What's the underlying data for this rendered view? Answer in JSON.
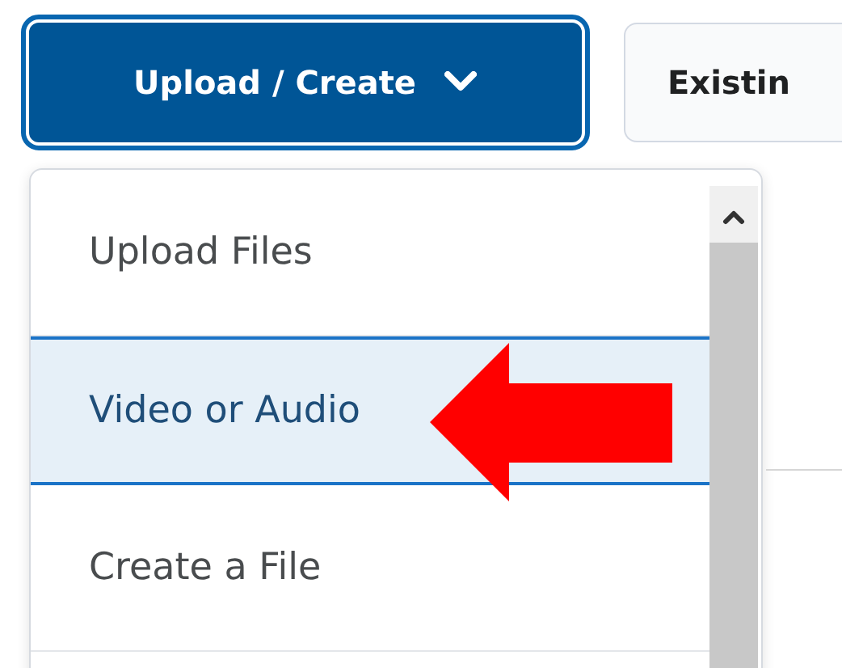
{
  "toolbar": {
    "buttons": [
      {
        "label": "Upload / Create",
        "kind": "dropdown",
        "focused": true
      },
      {
        "label": "Existin",
        "kind": "plain",
        "focused": false
      }
    ]
  },
  "menu": {
    "items": [
      {
        "label": "Upload Files",
        "selected": false
      },
      {
        "label": "Video or Audio",
        "selected": true
      },
      {
        "label": "Create a File",
        "selected": false
      }
    ]
  }
}
